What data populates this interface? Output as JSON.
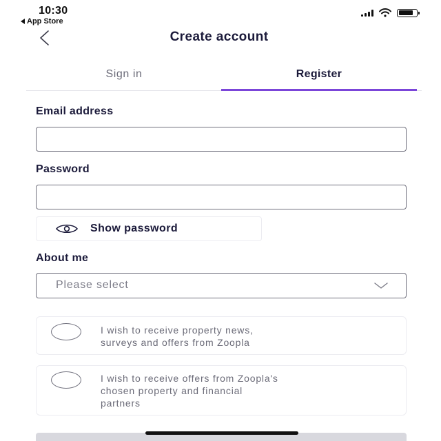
{
  "status_bar": {
    "time": "10:30",
    "back_app": "App Store"
  },
  "header": {
    "title": "Create account"
  },
  "tabs": [
    {
      "label": "Sign in",
      "active": false
    },
    {
      "label": "Register",
      "active": true
    }
  ],
  "form": {
    "email_label": "Email address",
    "email_value": "",
    "password_label": "Password",
    "password_value": "",
    "show_password_label": "Show password",
    "about_label": "About me",
    "about_placeholder": "Please select"
  },
  "consents": [
    {
      "text_lines": [
        "I wish to receive property news,",
        "surveys and offers from Zoopla"
      ],
      "checked": false
    },
    {
      "text_lines": [
        "I wish to receive offers from Zoopla's",
        "chosen property and financial",
        "partners"
      ],
      "checked": false
    }
  ],
  "colors": {
    "accent": "#7b45d9",
    "text_primary": "#1b1a3a",
    "text_secondary": "#6b6b78",
    "border": "#6f6f7c"
  },
  "icons": {
    "back": "chevron-left-icon",
    "eye": "eye-icon",
    "dropdown": "chevron-down-icon"
  }
}
